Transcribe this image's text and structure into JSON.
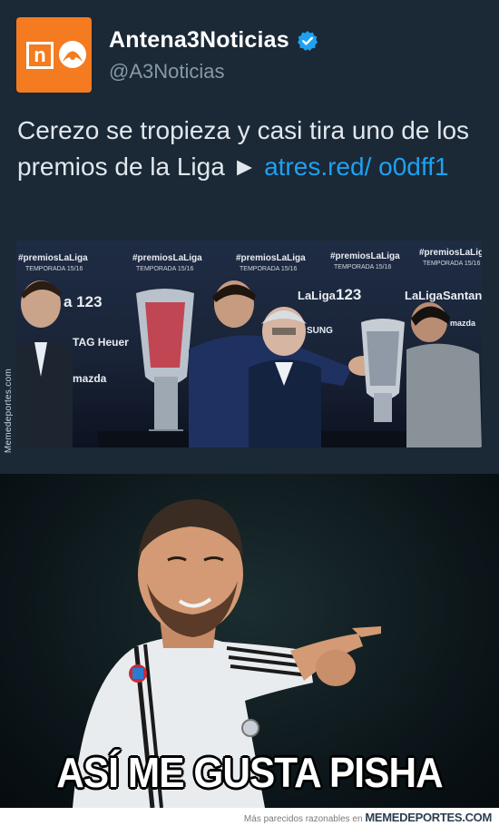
{
  "tweet": {
    "account_name": "Antena3Noticias",
    "handle": "@A3Noticias",
    "avatar_letter": "n",
    "text_main": "Cerezo se tropieza y casi tira uno de los premios de la Liga ► ",
    "link_text": "atres.red/ o0dff1",
    "icons": [
      "antena3-logo-icon",
      "verified-badge-icon"
    ],
    "accent_color": "#1da1f2",
    "brand_color": "#f47b20"
  },
  "photo": {
    "backdrop_texts": [
      "#premiosLaLiga",
      "TEMPORADA 15/16",
      "#premiosLaLiga",
      "TEMPORADA 15/16",
      "#premiosLaLiga",
      "TEMPORADA 15/16",
      "#premiosLaLiga",
      "TEMPORADA 15/16",
      "#premiosLaLiga",
      "TEMPORADA 15/16",
      "a 123",
      "LaLiga",
      "123",
      "LaLiga",
      "Santan",
      "TAG Heuer",
      "mazda",
      "mazda",
      "SUNG"
    ],
    "side_watermark": "Memedeportes.com"
  },
  "meme": {
    "caption": "ASÍ ME GUSTA PISHA"
  },
  "footer": {
    "prefix": "Más parecidos razonables en ",
    "brand": "MEMEDEPORTES.COM"
  }
}
